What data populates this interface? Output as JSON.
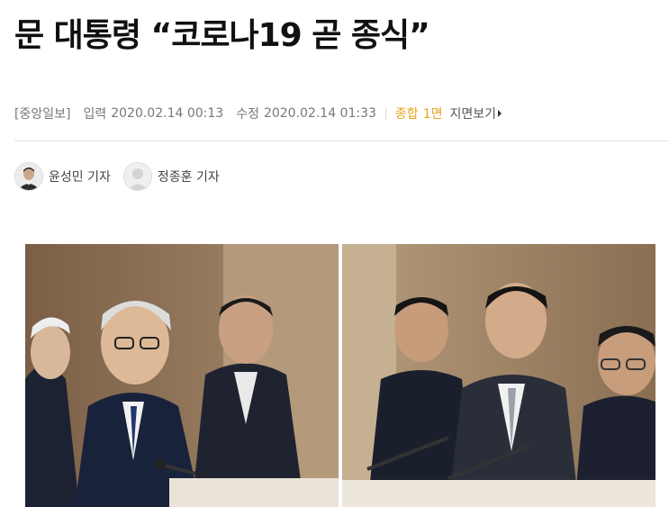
{
  "article": {
    "headline": "문 대통령 “코로나19 곧 종식”",
    "meta": {
      "source": "[중앙일보]",
      "input_label": "입력",
      "input_time": "2020.02.14 00:13",
      "modified_label": "수정",
      "modified_time": "2020.02.14 01:33",
      "section": "종합",
      "page": "1면",
      "viewer_link": "지면보기"
    },
    "reporters": [
      {
        "name": "윤성민 기자"
      },
      {
        "name": "정종훈 기자"
      }
    ]
  },
  "colors": {
    "accent": "#e8a317",
    "text": "#111111",
    "meta_text": "#777777"
  },
  "icons": {
    "reporter_1_avatar": "reporter-photo",
    "reporter_2_avatar": "default-user-icon",
    "viewer_arrow": "triangle-right-icon"
  }
}
